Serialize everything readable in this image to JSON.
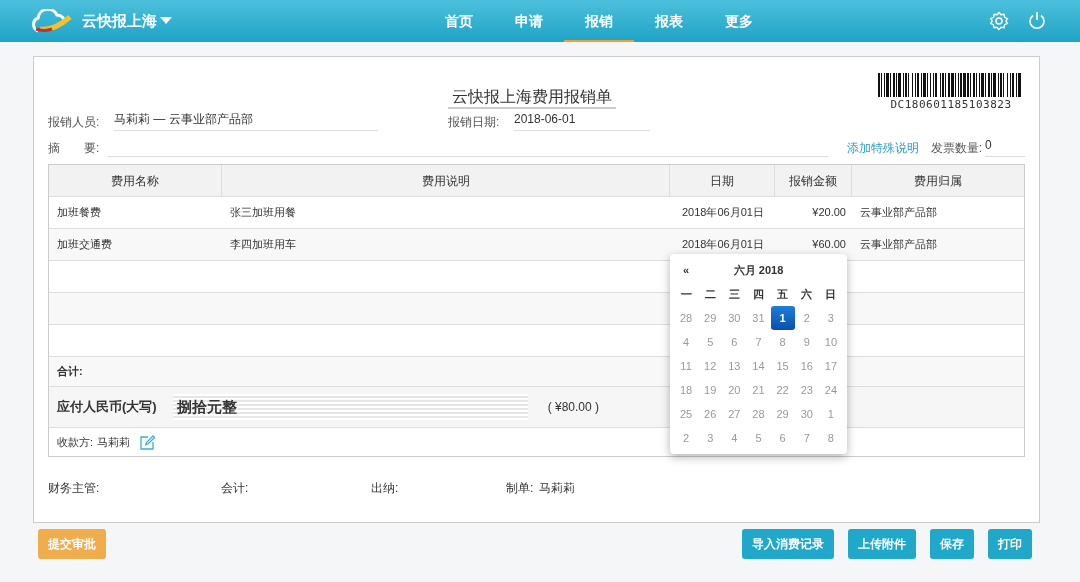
{
  "navbar": {
    "brand": "云快报上海",
    "menu": [
      {
        "label": "首页",
        "selected": false
      },
      {
        "label": "申请",
        "selected": false
      },
      {
        "label": "报销",
        "selected": true
      },
      {
        "label": "报表",
        "selected": false
      },
      {
        "label": "更多",
        "selected": false
      }
    ]
  },
  "form": {
    "title": "云快报上海费用报销单",
    "barcode": "DC180601185103823",
    "applicant": {
      "label": "报销人员:",
      "value": "马莉莉 — 云事业部产品部"
    },
    "date": {
      "label": "报销日期:",
      "value": "2018-06-01"
    },
    "summary": {
      "label": "摘　　要:"
    },
    "special_link": "添加特殊说明",
    "invoice_count": {
      "label": "发票数量:",
      "value": "0"
    },
    "table": {
      "columns": [
        "费用名称",
        "费用说明",
        "日期",
        "报销金额",
        "费用归属"
      ],
      "rows": [
        [
          "加班餐费",
          "张三加班用餐",
          "2018年06月01日",
          "¥20.00",
          "云事业部产品部"
        ],
        [
          "加班交通费",
          "李四加班用车",
          "2018年06月01日",
          "¥60.00",
          "云事业部产品部"
        ]
      ],
      "total_label": "合计:",
      "capital_label": "应付人民币(大写)",
      "capital_value": "捌拾元整",
      "capital_amount": "( ¥80.00 )",
      "payee_label": "收款方:",
      "payee_value": "马莉莉"
    },
    "signatures": [
      {
        "label": "财务主管:"
      },
      {
        "label": "会计:"
      },
      {
        "label": "出纳:"
      },
      {
        "label": "制单:",
        "value": "马莉莉"
      }
    ]
  },
  "calendar": {
    "prev": "«",
    "month": "六月 2018",
    "weekdays": [
      "一",
      "二",
      "三",
      "四",
      "五",
      "六",
      "日"
    ],
    "weeks": [
      [
        {
          "day": "28",
          "selected": false
        },
        {
          "day": "29",
          "selected": false
        },
        {
          "day": "30",
          "selected": false
        },
        {
          "day": "31",
          "selected": false
        },
        {
          "day": "1",
          "selected": true
        },
        {
          "day": "2",
          "selected": false
        },
        {
          "day": "3",
          "selected": false
        }
      ],
      [
        {
          "day": "4",
          "selected": false
        },
        {
          "day": "5",
          "selected": false
        },
        {
          "day": "6",
          "selected": false
        },
        {
          "day": "7",
          "selected": false
        },
        {
          "day": "8",
          "selected": false
        },
        {
          "day": "9",
          "selected": false
        },
        {
          "day": "10",
          "selected": false
        }
      ],
      [
        {
          "day": "11",
          "selected": false
        },
        {
          "day": "12",
          "selected": false
        },
        {
          "day": "13",
          "selected": false
        },
        {
          "day": "14",
          "selected": false
        },
        {
          "day": "15",
          "selected": false
        },
        {
          "day": "16",
          "selected": false
        },
        {
          "day": "17",
          "selected": false
        }
      ],
      [
        {
          "day": "18",
          "selected": false
        },
        {
          "day": "19",
          "selected": false
        },
        {
          "day": "20",
          "selected": false
        },
        {
          "day": "21",
          "selected": false
        },
        {
          "day": "22",
          "selected": false
        },
        {
          "day": "23",
          "selected": false
        },
        {
          "day": "24",
          "selected": false
        }
      ],
      [
        {
          "day": "25",
          "selected": false
        },
        {
          "day": "26",
          "selected": false
        },
        {
          "day": "27",
          "selected": false
        },
        {
          "day": "28",
          "selected": false
        },
        {
          "day": "29",
          "selected": false
        },
        {
          "day": "30",
          "selected": false
        },
        {
          "day": "1",
          "selected": false
        }
      ],
      [
        {
          "day": "2",
          "selected": false
        },
        {
          "day": "3",
          "selected": false
        },
        {
          "day": "4",
          "selected": false
        },
        {
          "day": "5",
          "selected": false
        },
        {
          "day": "6",
          "selected": false
        },
        {
          "day": "7",
          "selected": false
        },
        {
          "day": "8",
          "selected": false
        }
      ]
    ]
  },
  "footer": {
    "submit": "提交审批",
    "actions": [
      "导入消费记录",
      "上传附件",
      "保存",
      "打印"
    ]
  }
}
